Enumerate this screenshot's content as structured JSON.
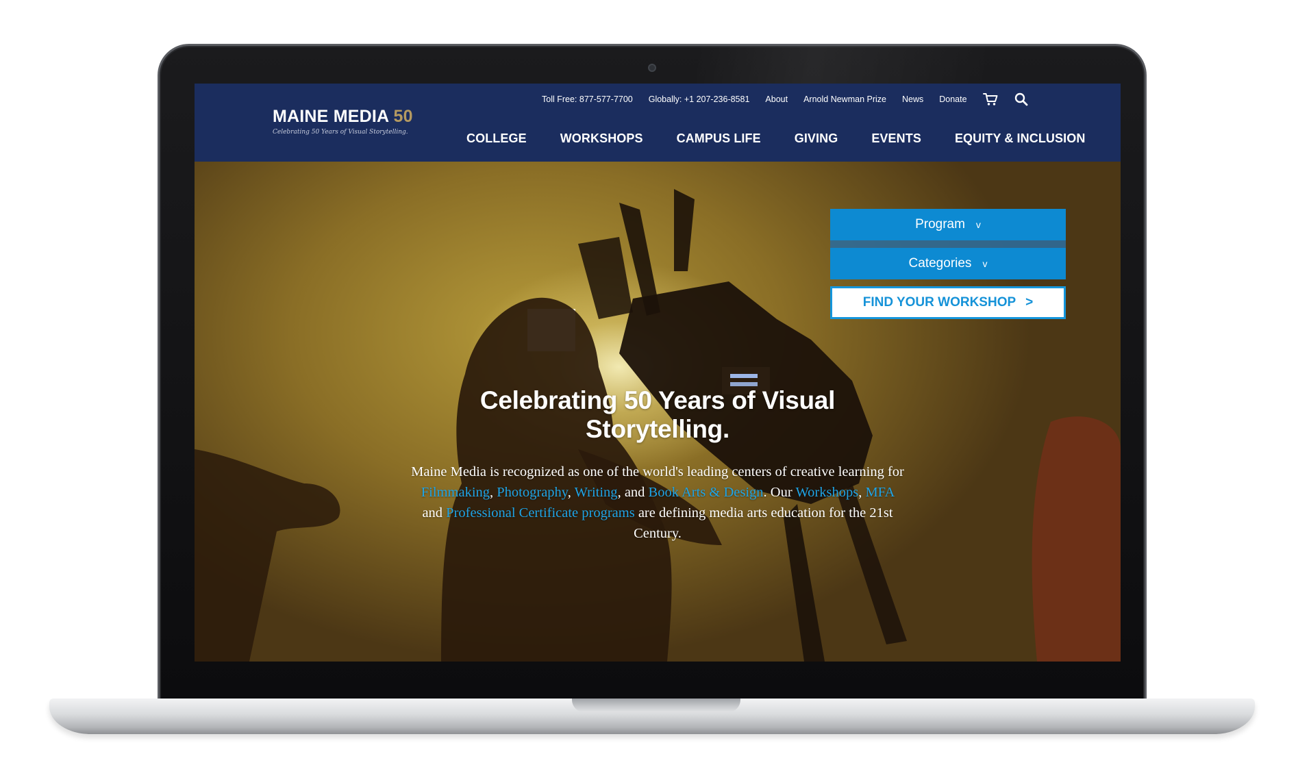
{
  "logo": {
    "name": "MAINE MEDIA",
    "number": "50",
    "tagline": "Celebrating 50 Years of Visual Storytelling."
  },
  "utility": {
    "toll_free": "Toll Free: 877-577-7700",
    "globally": "Globally: +1 207-236-8581",
    "about": "About",
    "prize": "Arnold Newman Prize",
    "news": "News",
    "donate": "Donate"
  },
  "nav": [
    "COLLEGE",
    "WORKSHOPS",
    "CAMPUS LIFE",
    "GIVING",
    "EVENTS",
    "EQUITY & INCLUSION"
  ],
  "finder": {
    "program": "Program",
    "categories": "Categories",
    "caret": "v",
    "button": "FIND YOUR WORKSHOP",
    "button_arrow": ">"
  },
  "hero": {
    "title": "Celebrating 50 Years of Visual Storytelling.",
    "t1": "Maine Media is recognized as one of the world's leading centers of creative learning for ",
    "filmmaking": "Filmmaking",
    "c1": ", ",
    "photography": "Photography",
    "c2": ", ",
    "writing": "Writing",
    "c3": ", and ",
    "book_arts": "Book Arts & Design",
    "t2": ". Our ",
    "workshops": "Workshops",
    "c4": ", ",
    "mfa": "MFA",
    "t3": " and ",
    "professional": "Professional Certificate programs",
    "t4": " are defining media arts education for the 21st Century."
  },
  "icons": {
    "cart": "cart-icon",
    "search": "search-icon",
    "camera": "webcam-icon"
  },
  "colors": {
    "header_bg": "#1b2d5e",
    "accent_blue": "#0d8ad2",
    "link_blue": "#1fa4e6",
    "logo_gold": "#b59a61"
  }
}
